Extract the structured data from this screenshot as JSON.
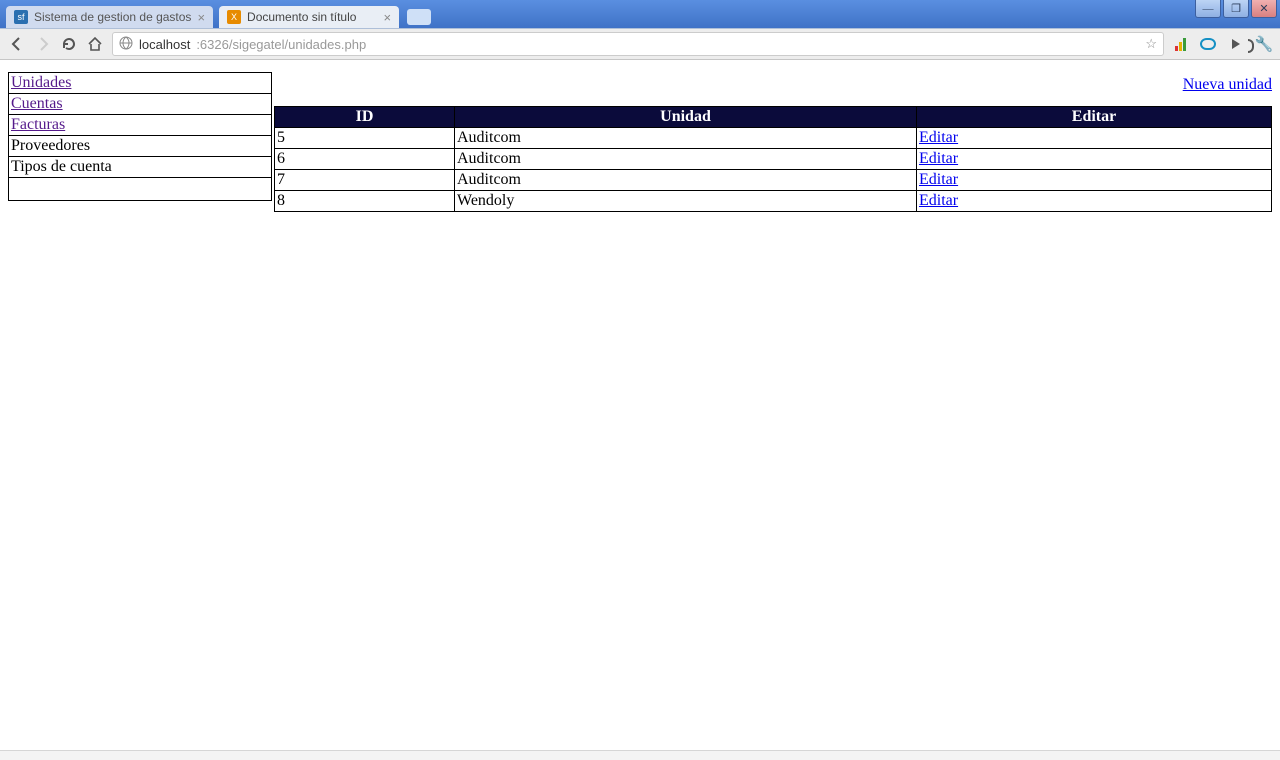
{
  "browser": {
    "tabs": [
      {
        "title": "Sistema de gestion de gastos",
        "favicon": "sf"
      },
      {
        "title": "Documento sin título",
        "favicon": "xa"
      }
    ],
    "active_tab_index": 1,
    "url_host": "localhost",
    "url_port_path": ":6326/sigegatel/unidades.php"
  },
  "sidebar": {
    "items": [
      {
        "label": "Unidades",
        "link": true,
        "visited": true
      },
      {
        "label": "Cuentas",
        "link": true,
        "visited": true
      },
      {
        "label": "Facturas",
        "link": true,
        "visited": true
      },
      {
        "label": "Proveedores",
        "link": false
      },
      {
        "label": "Tipos de cuenta",
        "link": false
      }
    ]
  },
  "actions": {
    "new_label": "Nueva unidad"
  },
  "table": {
    "headers": {
      "id": "ID",
      "unidad": "Unidad",
      "editar": "Editar"
    },
    "edit_label": "Editar",
    "rows": [
      {
        "id": "5",
        "unidad": "Auditcom"
      },
      {
        "id": "6",
        "unidad": "Auditcom"
      },
      {
        "id": "7",
        "unidad": "Auditcom"
      },
      {
        "id": "8",
        "unidad": "Wendoly"
      }
    ]
  }
}
